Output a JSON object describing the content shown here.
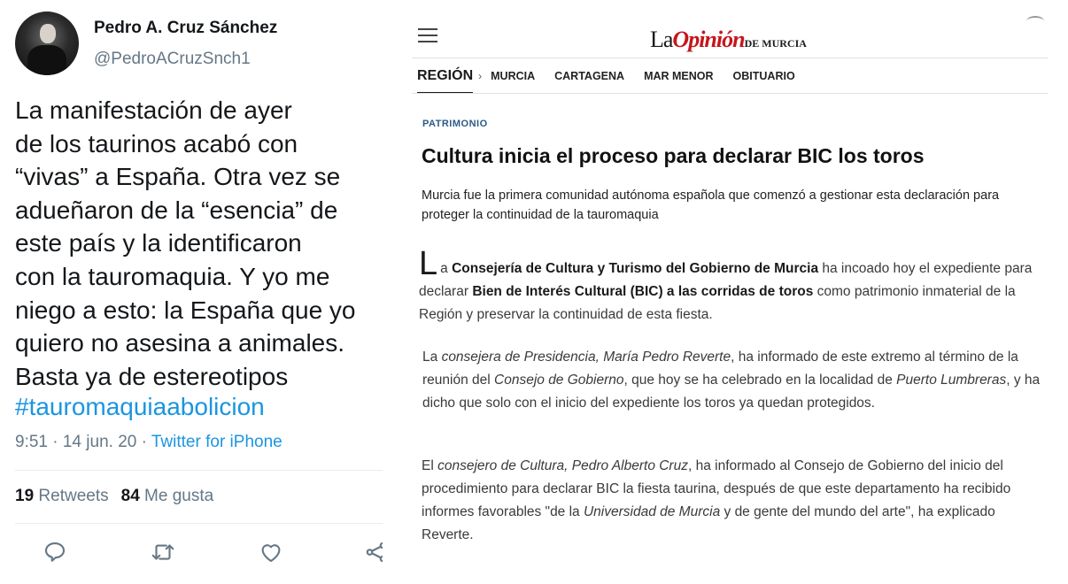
{
  "tweet": {
    "name": "Pedro A. Cruz Sánchez",
    "handle": "@PedroACruzSnch1",
    "text": "La manifestación de ayer\nde los taurinos acabó con\n“vivas” a España. Otra vez se\nadueñaron de la “esencia” de\neste país y la identificaron\ncon la tauromaquia. Y yo me\nniego a esto: la España que yo\nquiero no asesina a animales.\nBasta ya de estereotipos",
    "hashtag": "#tauromaquiaabolicion",
    "time": "9:51 · 14 jun. 20 · ",
    "source": "Twitter for iPhone",
    "retweets_count": "19",
    "retweets_label": "Retweets",
    "likes_count": "84",
    "likes_label": "Me gusta",
    "actions": [
      "reply-icon",
      "retweet-icon",
      "like-icon",
      "share-icon"
    ]
  },
  "news": {
    "logo_la": "La",
    "logo_opinion": "Opinión",
    "logo_de": "DE MURCIA",
    "nav": {
      "current": "REGIÓN",
      "chevron": "›",
      "items": [
        "MURCIA",
        "CARTAGENA",
        "MAR MENOR",
        "OBITUARIO"
      ]
    },
    "kicker": "PATRIMONIO",
    "headline": "Cultura inicia el proceso para declarar BIC los toros",
    "subtitle": "Murcia fue la primera comunidad autónoma española que comenzó a gestionar esta declaración para proteger la continuidad de la tauromaquia",
    "p1": {
      "dropcap": "L",
      "a": "a ",
      "b1": "Consejería de Cultura y Turismo del Gobierno de Murcia",
      "c": " ha incoado hoy el expediente para declarar ",
      "b2": "Bien de Interés Cultural (BIC) a las corridas de toros",
      "d": " como patrimonio inmaterial de la Región y preservar la continuidad de esta fiesta."
    },
    "p2": {
      "a": "La ",
      "i1": "consejera de Presidencia, María Pedro Reverte",
      "b": ", ha informado de este extremo al término de la reunión del ",
      "i2": "Consejo de Gobierno",
      "c": ", que hoy se ha celebrado en la localidad de ",
      "i3": "Puerto Lumbreras",
      "d": ", y ha dicho que solo con el inicio del expediente los toros ya quedan protegidos."
    },
    "p3": {
      "a": "El ",
      "i1": "consejero de Cultura, Pedro Alberto Cruz",
      "b": ", ha informado al Consejo de Gobierno del inicio del procedimiento para declarar BIC la fiesta taurina, después de que este departamento ha recibido informes favorables \"de la ",
      "i2": "Universidad de Murcia",
      "c": " y de gente del mundo del arte\", ha explicado Reverte."
    }
  }
}
